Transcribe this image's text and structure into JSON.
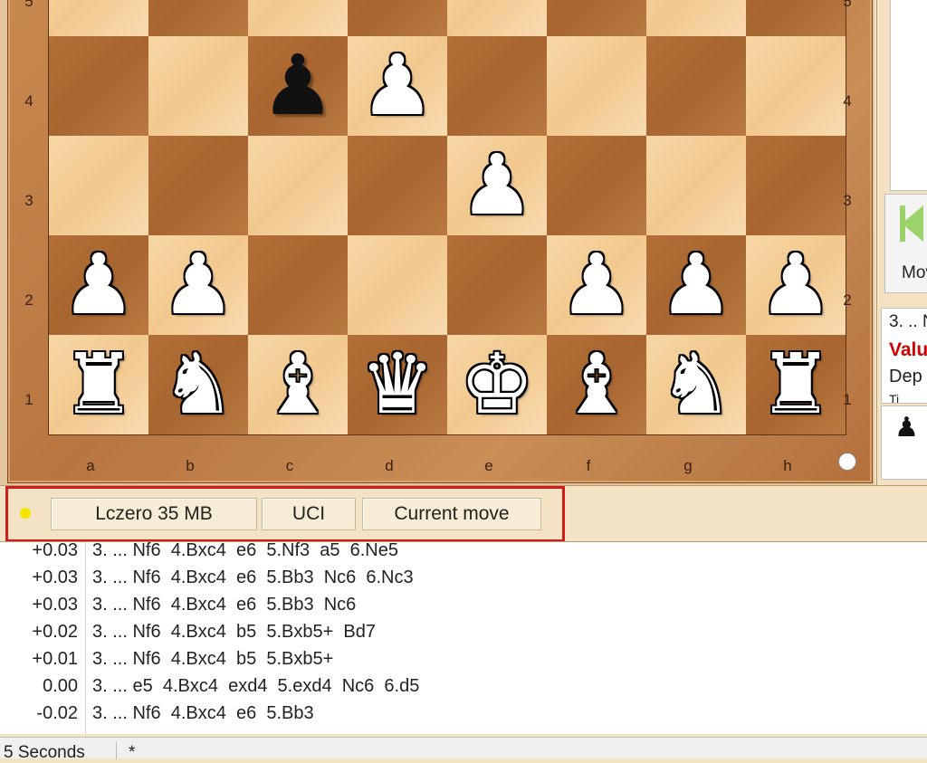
{
  "board": {
    "ranks_visible": [
      "5",
      "4",
      "3",
      "2",
      "1"
    ],
    "files": [
      "a",
      "b",
      "c",
      "d",
      "e",
      "f",
      "g",
      "h"
    ],
    "rows": [
      [
        "",
        "",
        "",
        "",
        "",
        "",
        "",
        ""
      ],
      [
        "",
        "",
        "♟",
        "♟",
        "",
        "",
        "",
        ""
      ],
      [
        "",
        "",
        "",
        "",
        "♟",
        "",
        "",
        ""
      ],
      [
        "♟",
        "♟",
        "",
        "",
        "",
        "♟",
        "♟",
        "♟"
      ],
      [
        "♜",
        "♞",
        "♝",
        "♛",
        "♚",
        "♝",
        "♞",
        "♜"
      ]
    ],
    "colors": [
      [
        "",
        "",
        "",
        "",
        "",
        "",
        "",
        ""
      ],
      [
        "",
        "",
        "black",
        "white",
        "",
        "",
        "",
        ""
      ],
      [
        "",
        "",
        "",
        "",
        "white",
        "",
        "",
        ""
      ],
      [
        "white",
        "white",
        "",
        "",
        "",
        "white",
        "white",
        "white"
      ],
      [
        "white",
        "white",
        "white",
        "white",
        "white",
        "white",
        "white",
        "white"
      ]
    ]
  },
  "right_panel": {
    "button_label": "Mov",
    "analysis_line1": "3. .. N",
    "analysis_line2": "Valu",
    "analysis_line3": "Dep",
    "analysis_line4": "Ti",
    "piece": "♟"
  },
  "engine": {
    "name": "Lczero  35 MB",
    "protocol": "UCI",
    "mode": "Current move",
    "status_color": "#f5e400"
  },
  "lines": [
    {
      "eval": "+0.03",
      "pv": "3. ... Nf6  4.Bxc4  e6  5.Nf3  a5  6.Ne5"
    },
    {
      "eval": "+0.03",
      "pv": "3. ... Nf6  4.Bxc4  e6  5.Bb3  Nc6  6.Nc3"
    },
    {
      "eval": "+0.03",
      "pv": "3. ... Nf6  4.Bxc4  e6  5.Bb3  Nc6"
    },
    {
      "eval": "+0.02",
      "pv": "3. ... Nf6  4.Bxc4  b5  5.Bxb5+  Bd7"
    },
    {
      "eval": "+0.01",
      "pv": "3. ... Nf6  4.Bxc4  b5  5.Bxb5+"
    },
    {
      "eval": "0.00",
      "pv": "3. ... e5  4.Bxc4  exd4  5.exd4  Nc6  6.d5"
    },
    {
      "eval": "-0.02",
      "pv": "3. ... Nf6  4.Bxc4  e6  5.Bb3"
    }
  ],
  "status_bar": {
    "time": "5 Seconds",
    "flag": "*"
  }
}
